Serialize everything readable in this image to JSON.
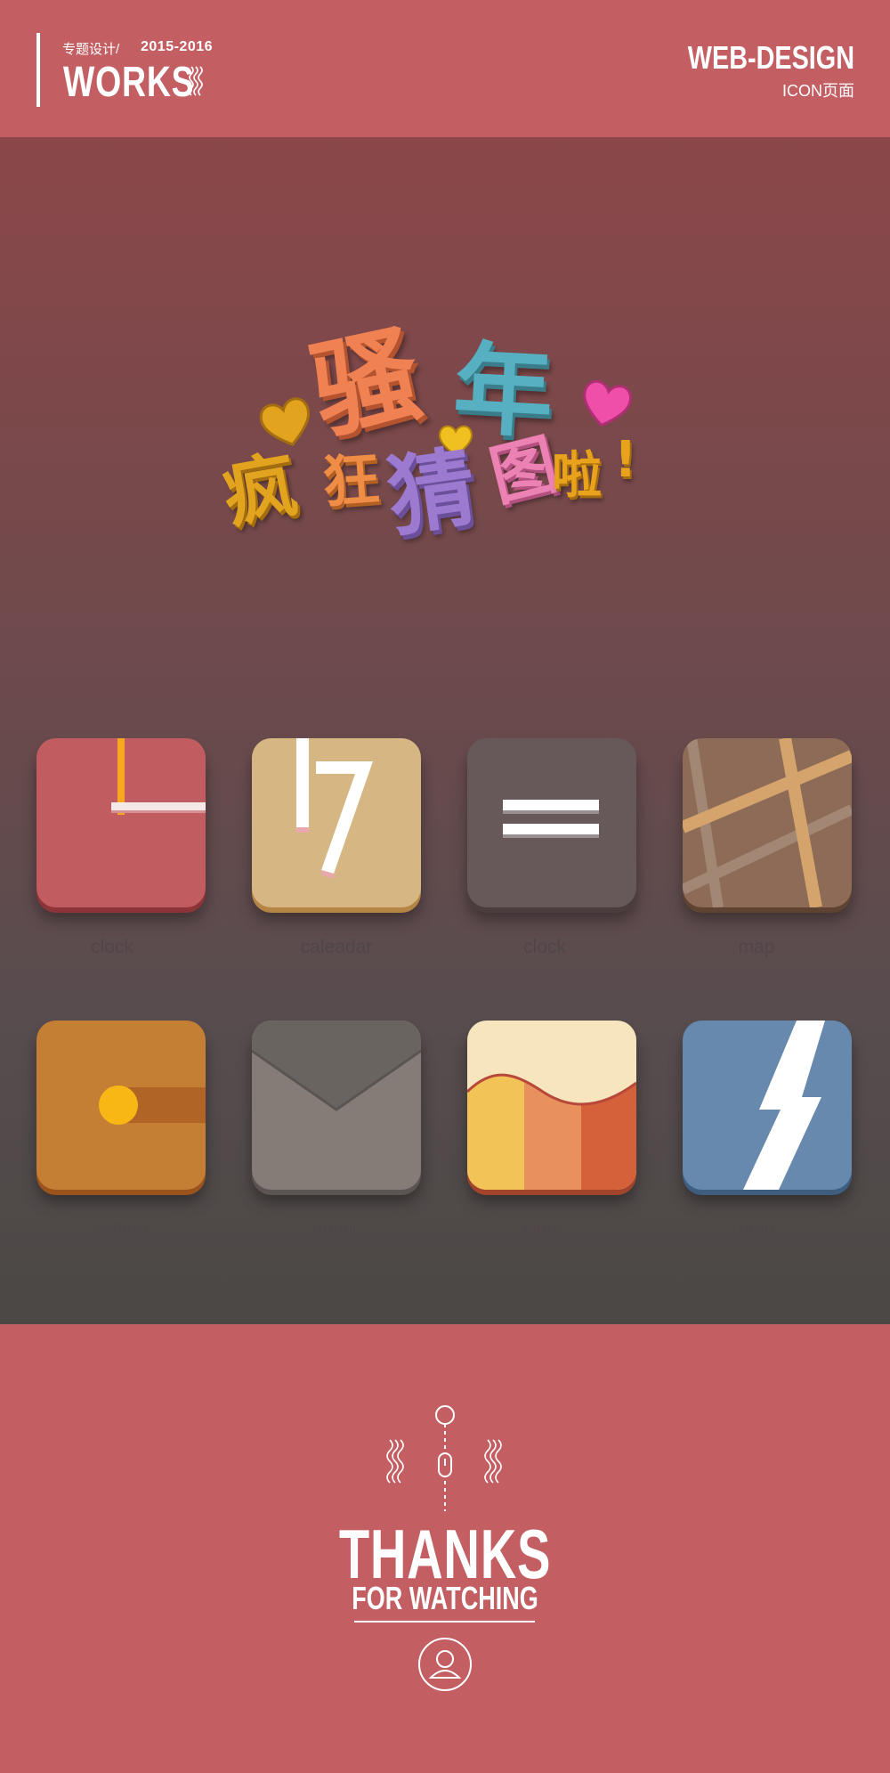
{
  "header": {
    "subtitle": "专题设计/",
    "years": "2015-2016",
    "works": "WORKS",
    "web_design": "WEB-DESIGN",
    "icon_page": "ICON页面"
  },
  "logo": {
    "line1": [
      "骚",
      "年"
    ],
    "line2": [
      "疯",
      "狂",
      "猜",
      "图",
      "啦",
      "!"
    ]
  },
  "icons": [
    {
      "name": "clock",
      "label": "clock",
      "color": "#c15c60"
    },
    {
      "name": "calendar",
      "label": "caleadar",
      "color": "#d6b683",
      "digit": "17"
    },
    {
      "name": "menu",
      "label": "clock",
      "color": "#675859"
    },
    {
      "name": "map",
      "label": "map",
      "color": "#8d6b56"
    },
    {
      "name": "setting",
      "label": "setting",
      "color": "#c47f35"
    },
    {
      "name": "email",
      "label": "email",
      "color": "#7e7776"
    },
    {
      "name": "chart",
      "label": "clock",
      "color": "#f7e5bd"
    },
    {
      "name": "flash",
      "label": "map",
      "color": "#6689ad"
    }
  ],
  "footer": {
    "thanks": "THANKS",
    "for_watching": "FOR WATCHING"
  }
}
